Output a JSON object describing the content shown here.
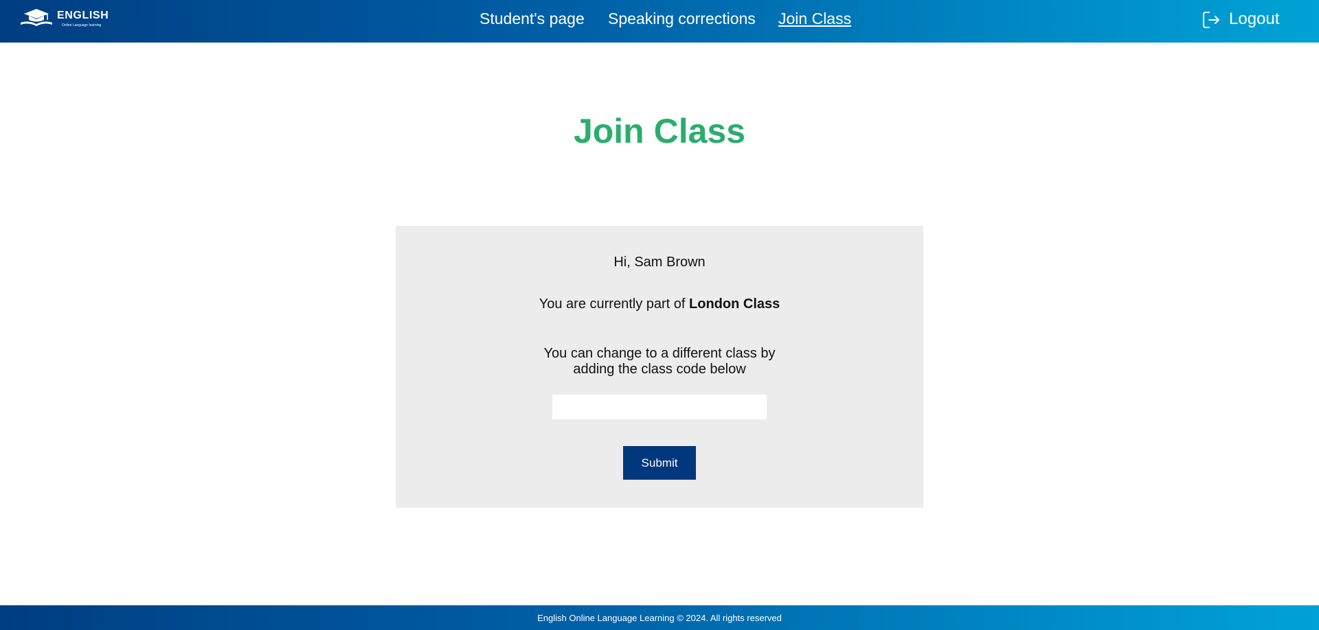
{
  "header": {
    "logo_title": "ENGLISH",
    "logo_subtitle": "Online Language learning",
    "nav": [
      {
        "label": "Student's page",
        "active": false
      },
      {
        "label": "Speaking corrections",
        "active": false
      },
      {
        "label": "Join Class",
        "active": true
      }
    ],
    "logout_label": "Logout",
    "logout_icon": "logout-icon",
    "gradient_start": "#003d82",
    "gradient_end": "#00a3d6"
  },
  "main": {
    "title": "Join Class",
    "title_color": "#2aad6e",
    "greeting": "Hi, Sam Brown",
    "current_prefix": "You are currently part of ",
    "current_class": "London Class",
    "instruction_line1": "You can change to a different class by",
    "instruction_line2": "adding the class code below",
    "class_code_value": "",
    "class_code_placeholder": "",
    "submit_label": "Submit",
    "submit_color": "#00377d"
  },
  "footer": {
    "text": "English Online Language Learning © 2024. All rights reserved"
  }
}
